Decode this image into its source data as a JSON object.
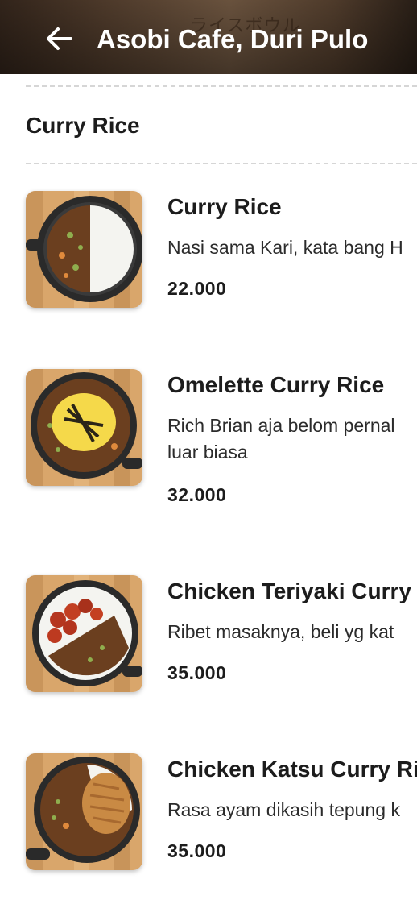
{
  "header": {
    "title": "Asobi Cafe, Duri Pulo",
    "back_icon": "arrow-left-icon",
    "background_text": "ライスボウル"
  },
  "section": {
    "title": "Curry Rice"
  },
  "items": [
    {
      "name": "Curry Rice",
      "description_lines": [
        "Nasi sama Kari, kata bang H"
      ],
      "price": "22.000",
      "image": "curry-rice-photo"
    },
    {
      "name": "Omelette Curry Rice",
      "description_lines": [
        "Rich Brian aja belom pernal",
        "luar biasa"
      ],
      "price": "32.000",
      "image": "omelette-curry-rice-photo"
    },
    {
      "name": "Chicken Teriyaki Curry",
      "description_lines": [
        "Ribet masaknya, beli yg kat"
      ],
      "price": "35.000",
      "image": "chicken-teriyaki-curry-photo"
    },
    {
      "name": "Chicken Katsu Curry Ri",
      "description_lines": [
        "Rasa ayam dikasih tepung k"
      ],
      "price": "35.000",
      "image": "chicken-katsu-curry-photo"
    }
  ],
  "colors": {
    "accent_text": "#1c1c1c",
    "divider": "#d6d6d6",
    "wood": "#d9a66b",
    "pan": "#2a2a2a",
    "curry": "#6b3f1f"
  }
}
